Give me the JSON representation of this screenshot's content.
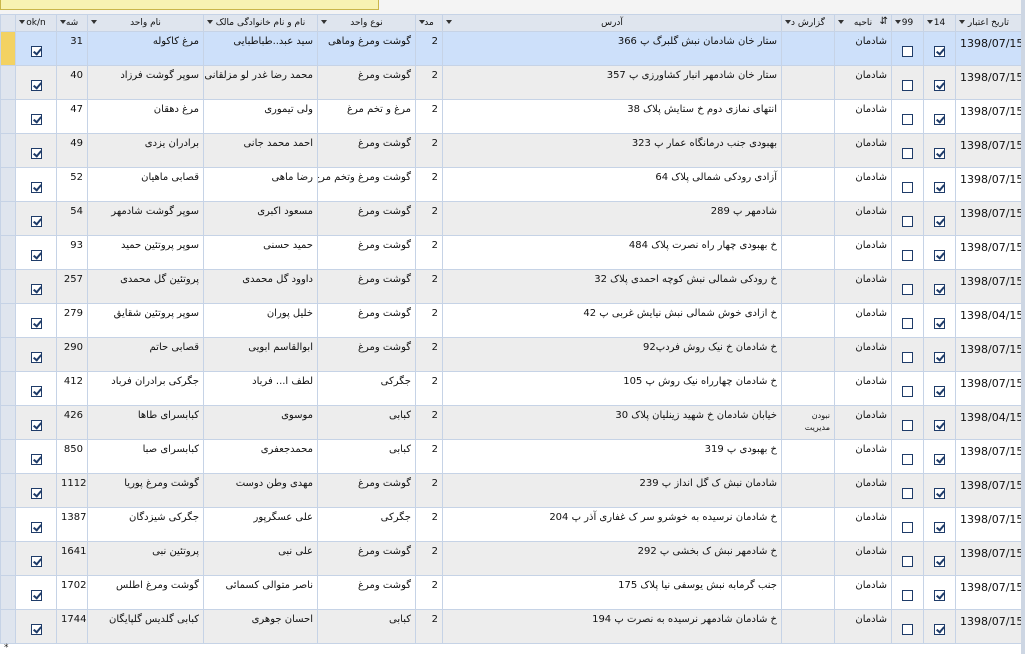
{
  "columns": {
    "oknot": "ok/n",
    "num": "شه",
    "unit_name": "نام واحد",
    "owner": "نام و نام خانوادگی مالک",
    "unit_type": "نوع  واحد",
    "code": "مد",
    "address": "آدرس",
    "report": "گزارش د",
    "district": "ناحیه",
    "c99": "99",
    "c14": "14",
    "date": "تاریخ اعتبار"
  },
  "rows": [
    {
      "ok": true,
      "num": "31",
      "name": "مرغ کاکوله",
      "owner": "سید عبد..طباطبایی",
      "type": "گوشت ومرغ وماهی",
      "code": "2",
      "address": "ستار خان شادمان نبش گلبرگ پ 366",
      "report": "",
      "district": "شادمان",
      "c99": false,
      "c14": true,
      "date": "1398/07/15"
    },
    {
      "ok": true,
      "num": "40",
      "name": "سوپر گوشت فرزاد",
      "owner": "محمد رضا  غدر لو مزلقانی",
      "type": "گوشت ومرغ",
      "code": "2",
      "address": "ستار خان شادمهر  انبار کشاورزی پ 357",
      "report": "",
      "district": "شادمان",
      "c99": false,
      "c14": true,
      "date": "1398/07/15"
    },
    {
      "ok": true,
      "num": "47",
      "name": "مرغ دهقان",
      "owner": "ولی تیموری",
      "type": "مرغ و تخم مرغ",
      "code": "2",
      "address": "انتهای نمازی دوم خ ستایش پلاک 38",
      "report": "",
      "district": "شادمان",
      "c99": false,
      "c14": true,
      "date": "1398/07/15"
    },
    {
      "ok": true,
      "num": "49",
      "name": "برادران یزدی",
      "owner": "احمد محمد جانی",
      "type": "گوشت ومرغ",
      "code": "2",
      "address": "بهبودی جنب درمانگاه عمار پ 323",
      "report": "",
      "district": "شادمان",
      "c99": false,
      "c14": true,
      "date": "1398/07/15"
    },
    {
      "ok": true,
      "num": "52",
      "name": "قصابی ماهیان",
      "owner": "رضا ماهی",
      "type": "گوشت ومرغ وتخم مرغ",
      "code": "2",
      "address": "آزادی رودکی شمالی پلاک 64",
      "report": "",
      "district": "شادمان",
      "c99": false,
      "c14": true,
      "date": "1398/07/15"
    },
    {
      "ok": true,
      "num": "54",
      "name": "سوپر گوشت شادمهر",
      "owner": "مسعود اکبری",
      "type": "گوشت ومرغ",
      "code": "2",
      "address": "شادمهر پ 289",
      "report": "",
      "district": "شادمان",
      "c99": false,
      "c14": true,
      "date": "1398/07/15"
    },
    {
      "ok": true,
      "num": "93",
      "name": "سوپر پروتئین حمید",
      "owner": "حمید حسنی",
      "type": "گوشت ومرغ",
      "code": "2",
      "address": "خ بهبودی چهار راه نصرت پلاک 484",
      "report": "",
      "district": "شادمان",
      "c99": false,
      "c14": true,
      "date": "1398/07/15"
    },
    {
      "ok": true,
      "num": "257",
      "name": "پروتئین گل محمدی",
      "owner": "داوود گل محمدی",
      "type": "گوشت ومرغ",
      "code": "2",
      "address": "خ رودکی شمالی نبش کوچه احمدی پلاک 32",
      "report": "",
      "district": "شادمان",
      "c99": false,
      "c14": true,
      "date": "1398/07/15"
    },
    {
      "ok": true,
      "num": "279",
      "name": "سوپر پروتئین شقایق",
      "owner": "خلیل پوران",
      "type": "گوشت ومرغ",
      "code": "2",
      "address": "خ ازادی خوش شمالی نبش نیایش غربی  پ 42",
      "report": "",
      "district": "شادمان",
      "c99": false,
      "c14": true,
      "date": "1398/04/15"
    },
    {
      "ok": true,
      "num": "290",
      "name": "قصابی حاتم",
      "owner": "ابوالقاسم ابویی",
      "type": "گوشت ومرغ",
      "code": "2",
      "address": "خ شادمان خ نیک روش فردپ92",
      "report": "",
      "district": "شادمان",
      "c99": false,
      "c14": true,
      "date": "1398/07/15"
    },
    {
      "ok": true,
      "num": "412",
      "name": "جگرکی  برادران فرباد",
      "owner": "لطف ا... فرباد",
      "type": "جگرکی",
      "code": "2",
      "address": "خ شادمان چهارراه  نیک روش پ 105",
      "report": "",
      "district": "شادمان",
      "c99": false,
      "c14": true,
      "date": "1398/07/15"
    },
    {
      "ok": true,
      "num": "426",
      "name": "کبابسرای طاها",
      "owner": "موسوی",
      "type": "کبابی",
      "code": "2",
      "address": "خیابان شادمان خ شهید زینلیان پلاک 30",
      "report": "نبودن مدیریت",
      "district": "شادمان",
      "c99": false,
      "c14": true,
      "date": "1398/04/15"
    },
    {
      "ok": true,
      "num": "850",
      "name": "کبابسرای صبا",
      "owner": "محمدجعفری",
      "type": "کبابی",
      "code": "2",
      "address": "خ بهبودی  پ 319",
      "report": "",
      "district": "شادمان",
      "c99": false,
      "c14": true,
      "date": "1398/07/15"
    },
    {
      "ok": true,
      "num": "1112",
      "name": "گوشت ومرغ پوریا",
      "owner": "مهدی وطن دوست",
      "type": "گوشت ومرغ",
      "code": "2",
      "address": "شادمان نبش ک گل انداز پ 239",
      "report": "",
      "district": "شادمان",
      "c99": false,
      "c14": true,
      "date": "1398/07/15"
    },
    {
      "ok": true,
      "num": "1387",
      "name": "جگرکی شیزدگان",
      "owner": "علی عسگرپور",
      "type": "جگرکی",
      "code": "2",
      "address": "خ شادمان نرسیده به خوشرو سر ک غفاری آذر پ 204",
      "report": "",
      "district": "شادمان",
      "c99": false,
      "c14": true,
      "date": "1398/07/15"
    },
    {
      "ok": true,
      "num": "1641",
      "name": "پروتئین نبی",
      "owner": "علی نبی",
      "type": "گوشت ومرغ",
      "code": "2",
      "address": "خ شادمهر نبش ک بخشی پ 292",
      "report": "",
      "district": "شادمان",
      "c99": false,
      "c14": true,
      "date": "1398/07/15"
    },
    {
      "ok": true,
      "num": "1702",
      "name": "گوشت ومرغ اطلس",
      "owner": "ناصر متوالی کسمائی",
      "type": "گوشت ومرغ",
      "code": "2",
      "address": "جنب گرمابه نبش یوسفی نیا پلاک 175",
      "report": "",
      "district": "شادمان",
      "c99": false,
      "c14": true,
      "date": "1398/07/15"
    },
    {
      "ok": true,
      "num": "1744",
      "name": "کبابی گلدیس گلپایگان",
      "owner": "احسان جوهری",
      "type": "کبابی",
      "code": "2",
      "address": "خ شادمان شادمهر نرسیده به نصرت پ 194",
      "report": "",
      "district": "شادمان",
      "c99": false,
      "c14": true,
      "date": "1398/07/15"
    }
  ],
  "new_row_marker": "*"
}
